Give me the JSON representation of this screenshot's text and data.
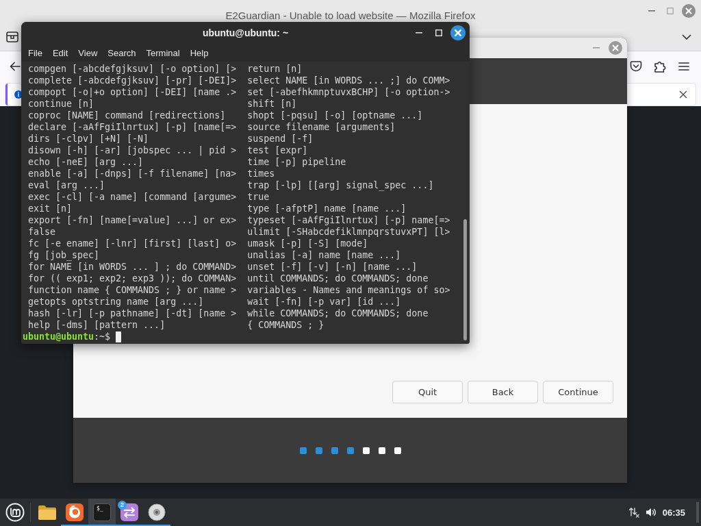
{
  "browser_window": {
    "title": "E2Guardian - Unable to load website — Mozilla Firefox"
  },
  "installer_window": {
    "buttons": [
      {
        "label": "Quit"
      },
      {
        "label": "Back"
      },
      {
        "label": "Continue"
      }
    ],
    "progress_steps": [
      {
        "done": true
      },
      {
        "done": true
      },
      {
        "done": true
      },
      {
        "done": true
      },
      {
        "done": false
      },
      {
        "done": false
      },
      {
        "done": false
      }
    ]
  },
  "terminal_window": {
    "title": "ubuntu@ubuntu: ~",
    "menu": [
      "File",
      "Edit",
      "View",
      "Search",
      "Terminal",
      "Help"
    ],
    "left_column": [
      "compgen [-abcdefgjksuv] [-o option] [>",
      "complete [-abcdefgjksuv] [-pr] [-DEI]>",
      "compopt [-o|+o option] [-DEI] [name .>",
      "continue [n]",
      "coproc [NAME] command [redirections]",
      "declare [-aAfFgiIlnrtux] [-p] [name[=>",
      "dirs [-clpv] [+N] [-N]",
      "disown [-h] [-ar] [jobspec ... | pid >",
      "echo [-neE] [arg ...]",
      "enable [-a] [-dnps] [-f filename] [na>",
      "eval [arg ...]",
      "exec [-cl] [-a name] [command [argume>",
      "exit [n]",
      "export [-fn] [name[=value] ...] or ex>",
      "false",
      "fc [-e ename] [-lnr] [first] [last] o>",
      "fg [job_spec]",
      "for NAME [in WORDS ... ] ; do COMMAND>",
      "for (( exp1; exp2; exp3 )); do COMMAN>",
      "function name { COMMANDS ; } or name >",
      "getopts optstring name [arg ...]",
      "hash [-lr] [-p pathname] [-dt] [name >",
      "help [-dms] [pattern ...]"
    ],
    "right_column": [
      "return [n]",
      "select NAME [in WORDS ... ;] do COMM>",
      "set [-abefhkmnptuvxBCHP] [-o option->",
      "shift [n]",
      "shopt [-pqsu] [-o] [optname ...]",
      "source filename [arguments]",
      "suspend [-f]",
      "test [expr]",
      "time [-p] pipeline",
      "times",
      "trap [-lp] [[arg] signal_spec ...]",
      "true",
      "type [-afptP] name [name ...]",
      "typeset [-aAfFgiIlnrtux] [-p] name[=>",
      "ulimit [-SHabcdefiklmnpqrstuvxPT] [l>",
      "umask [-p] [-S] [mode]",
      "unalias [-a] name [name ...]",
      "unset [-f] [-v] [-n] [name ...]",
      "until COMMANDS; do COMMANDS; done",
      "variables - Names and meanings of so>",
      "wait [-fn] [-p var] [id ...]",
      "while COMMANDS; do COMMANDS; done",
      "{ COMMANDS ; }"
    ],
    "prompt": {
      "user_host": "ubuntu@ubuntu",
      "path": ":~$"
    }
  },
  "taskbar": {
    "apps": [
      {
        "kind": "folder",
        "running": false,
        "selected": false
      },
      {
        "kind": "browser",
        "running": true,
        "selected": false
      },
      {
        "kind": "terminal",
        "running": true,
        "selected": true,
        "glyph": "$_"
      },
      {
        "kind": "transfer",
        "running": true,
        "selected": false,
        "badge": "2"
      },
      {
        "kind": "disc",
        "running": true,
        "selected": false
      }
    ],
    "clock": "06:35"
  }
}
